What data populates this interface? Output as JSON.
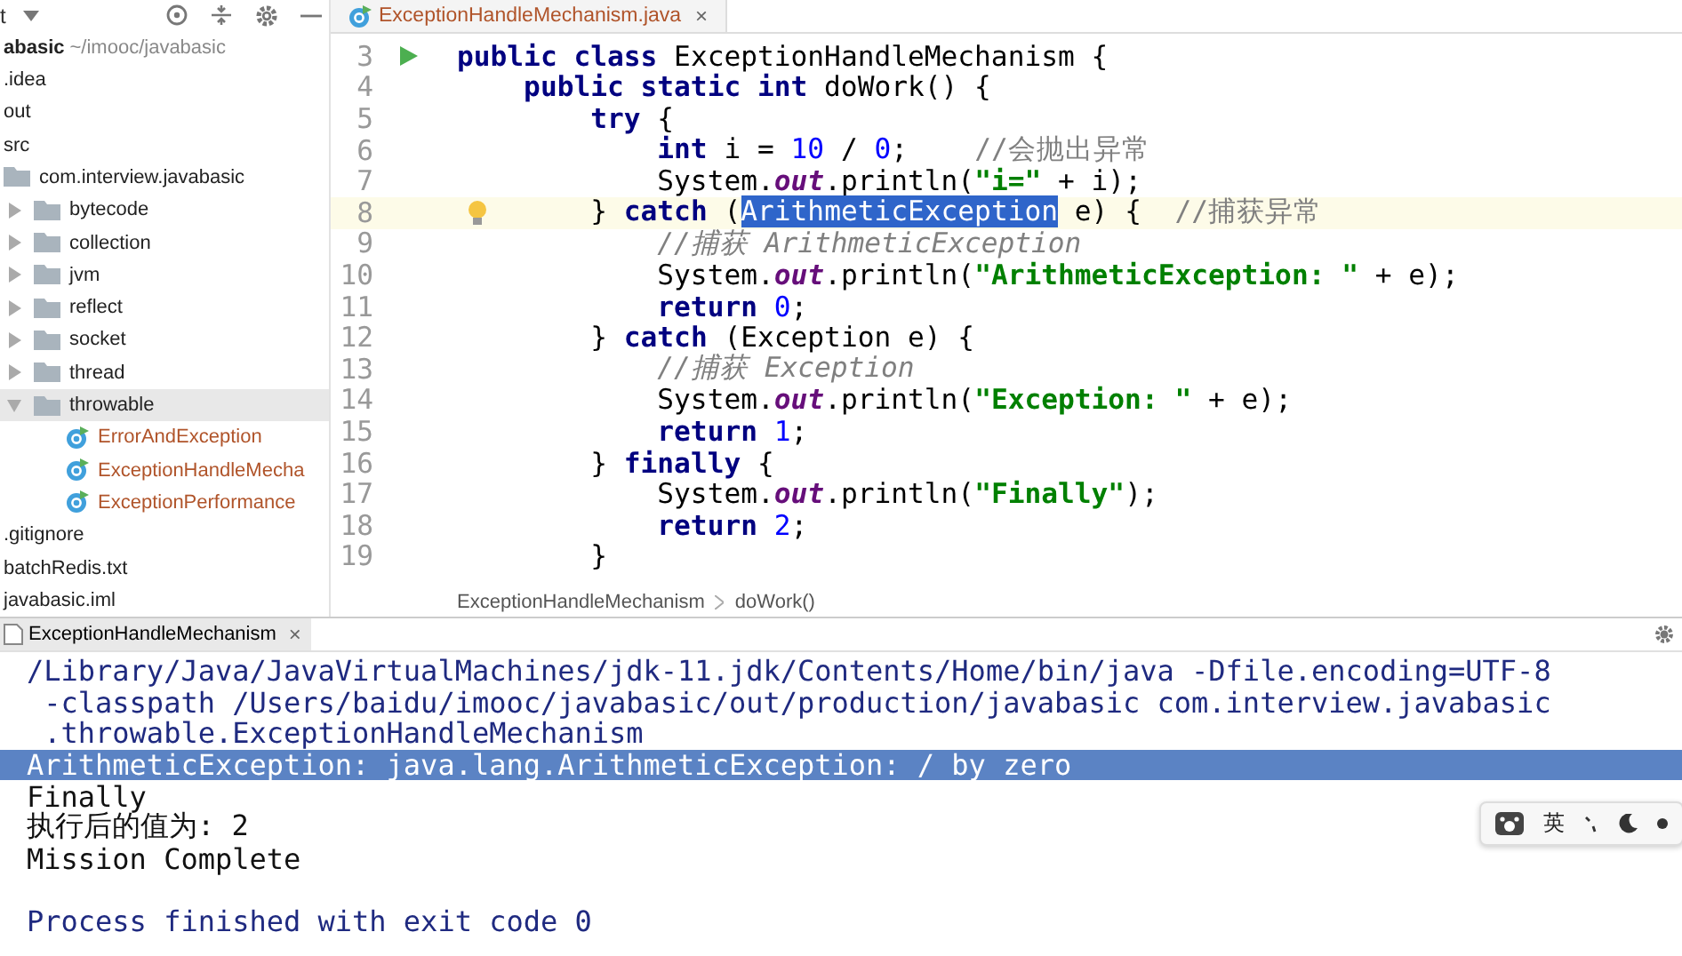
{
  "project_panel": {
    "title": "t",
    "tree": [
      {
        "label": "abasic",
        "path": "~/imooc/javabasic",
        "kind": "root",
        "selected": false,
        "children": [
          {
            "label": ".idea",
            "kind": "plain",
            "selected": false
          },
          {
            "label": "out",
            "kind": "plain",
            "selected": false
          },
          {
            "label": "src",
            "kind": "plain",
            "selected": false,
            "children": [
              {
                "label": "com.interview.javabasic",
                "kind": "package",
                "selected": false,
                "children": [
                  {
                    "label": "bytecode",
                    "kind": "folder",
                    "expanded": false,
                    "selected": false
                  },
                  {
                    "label": "collection",
                    "kind": "folder",
                    "expanded": false,
                    "selected": false
                  },
                  {
                    "label": "jvm",
                    "kind": "folder",
                    "expanded": false,
                    "selected": false
                  },
                  {
                    "label": "reflect",
                    "kind": "folder",
                    "expanded": false,
                    "selected": false
                  },
                  {
                    "label": "socket",
                    "kind": "folder",
                    "expanded": false,
                    "selected": false
                  },
                  {
                    "label": "thread",
                    "kind": "folder",
                    "expanded": false,
                    "selected": false
                  },
                  {
                    "label": "throwable",
                    "kind": "folder",
                    "expanded": true,
                    "selected": true,
                    "children": [
                      {
                        "label": "ErrorAndException",
                        "kind": "class",
                        "selected": false
                      },
                      {
                        "label": "ExceptionHandleMecha",
                        "kind": "class",
                        "selected": false
                      },
                      {
                        "label": "ExceptionPerformance",
                        "kind": "class",
                        "selected": false
                      }
                    ]
                  }
                ]
              }
            ]
          },
          {
            "label": ".gitignore",
            "kind": "plain",
            "selected": false
          },
          {
            "label": "batchRedis.txt",
            "kind": "plain",
            "selected": false
          },
          {
            "label": "javabasic.iml",
            "kind": "plain",
            "selected": false
          }
        ]
      }
    ]
  },
  "editor": {
    "tab": {
      "label": "ExceptionHandleMechanism.java",
      "close": "×"
    },
    "lines": [
      {
        "number": "3",
        "current": false,
        "runnable": true,
        "hint": false,
        "tokens": [
          {
            "kind": "kw",
            "text": "public class"
          },
          {
            "kind": "plain",
            "text": " ExceptionHandleMechanism {"
          }
        ]
      },
      {
        "number": "4",
        "current": false,
        "runnable": false,
        "hint": false,
        "tokens": [
          {
            "kind": "kw",
            "text": "    public static int"
          },
          {
            "kind": "plain",
            "text": " doWork() {"
          }
        ]
      },
      {
        "number": "5",
        "current": false,
        "runnable": false,
        "hint": false,
        "tokens": [
          {
            "kind": "kw",
            "text": "        try"
          },
          {
            "kind": "plain",
            "text": " {"
          }
        ]
      },
      {
        "number": "6",
        "current": false,
        "runnable": false,
        "hint": false,
        "tokens": [
          {
            "kind": "kw",
            "text": "            int"
          },
          {
            "kind": "plain",
            "text": " i = "
          },
          {
            "kind": "num",
            "text": "10"
          },
          {
            "kind": "plain",
            "text": " / "
          },
          {
            "kind": "num",
            "text": "0"
          },
          {
            "kind": "plain",
            "text": ";    "
          },
          {
            "kind": "comment",
            "text": "//会抛出异常"
          }
        ]
      },
      {
        "number": "7",
        "current": false,
        "runnable": false,
        "hint": false,
        "tokens": [
          {
            "kind": "plain",
            "text": "            System."
          },
          {
            "kind": "field",
            "text": "out"
          },
          {
            "kind": "plain",
            "text": ".println("
          },
          {
            "kind": "str",
            "text": "\"i=\""
          },
          {
            "kind": "plain",
            "text": " + i);"
          }
        ]
      },
      {
        "number": "8",
        "current": true,
        "runnable": false,
        "hint": true,
        "tokens": [
          {
            "kind": "plain",
            "text": "        } "
          },
          {
            "kind": "kw",
            "text": "catch"
          },
          {
            "kind": "plain",
            "text": " ("
          },
          {
            "kind": "selection",
            "text": "ArithmeticException"
          },
          {
            "kind": "plain",
            "text": " e) {  "
          },
          {
            "kind": "comment",
            "text": "//捕获异常"
          }
        ]
      },
      {
        "number": "9",
        "current": false,
        "runnable": false,
        "hint": false,
        "tokens": [
          {
            "kind": "doc",
            "text": "            //捕获 ArithmeticException"
          }
        ]
      },
      {
        "number": "10",
        "current": false,
        "runnable": false,
        "hint": false,
        "tokens": [
          {
            "kind": "plain",
            "text": "            System."
          },
          {
            "kind": "field",
            "text": "out"
          },
          {
            "kind": "plain",
            "text": ".println("
          },
          {
            "kind": "str",
            "text": "\"ArithmeticException: \""
          },
          {
            "kind": "plain",
            "text": " + e);"
          }
        ]
      },
      {
        "number": "11",
        "current": false,
        "runnable": false,
        "hint": false,
        "tokens": [
          {
            "kind": "kw",
            "text": "            return"
          },
          {
            "kind": "num",
            "text": " 0"
          },
          {
            "kind": "plain",
            "text": ";"
          }
        ]
      },
      {
        "number": "12",
        "current": false,
        "runnable": false,
        "hint": false,
        "tokens": [
          {
            "kind": "plain",
            "text": "        } "
          },
          {
            "kind": "kw",
            "text": "catch"
          },
          {
            "kind": "plain",
            "text": " (Exception e) {"
          }
        ]
      },
      {
        "number": "13",
        "current": false,
        "runnable": false,
        "hint": false,
        "tokens": [
          {
            "kind": "doc",
            "text": "            //捕获 Exception"
          }
        ]
      },
      {
        "number": "14",
        "current": false,
        "runnable": false,
        "hint": false,
        "tokens": [
          {
            "kind": "plain",
            "text": "            System."
          },
          {
            "kind": "field",
            "text": "out"
          },
          {
            "kind": "plain",
            "text": ".println("
          },
          {
            "kind": "str",
            "text": "\"Exception: \""
          },
          {
            "kind": "plain",
            "text": " + e);"
          }
        ]
      },
      {
        "number": "15",
        "current": false,
        "runnable": false,
        "hint": false,
        "tokens": [
          {
            "kind": "kw",
            "text": "            return"
          },
          {
            "kind": "num",
            "text": " 1"
          },
          {
            "kind": "plain",
            "text": ";"
          }
        ]
      },
      {
        "number": "16",
        "current": false,
        "runnable": false,
        "hint": false,
        "tokens": [
          {
            "kind": "plain",
            "text": "        } "
          },
          {
            "kind": "kw",
            "text": "finally"
          },
          {
            "kind": "plain",
            "text": " {"
          }
        ]
      },
      {
        "number": "17",
        "current": false,
        "runnable": false,
        "hint": false,
        "tokens": [
          {
            "kind": "plain",
            "text": "            System."
          },
          {
            "kind": "field",
            "text": "out"
          },
          {
            "kind": "plain",
            "text": ".println("
          },
          {
            "kind": "str",
            "text": "\"Finally\""
          },
          {
            "kind": "plain",
            "text": ");"
          }
        ]
      },
      {
        "number": "18",
        "current": false,
        "runnable": false,
        "hint": false,
        "tokens": [
          {
            "kind": "kw",
            "text": "            return"
          },
          {
            "kind": "num",
            "text": " 2"
          },
          {
            "kind": "plain",
            "text": ";"
          }
        ]
      },
      {
        "number": "19",
        "current": false,
        "runnable": false,
        "hint": false,
        "tokens": [
          {
            "kind": "plain",
            "text": "        }"
          }
        ]
      }
    ],
    "breadcrumb": [
      "ExceptionHandleMechanism",
      "doWork()"
    ]
  },
  "console": {
    "tab": {
      "label": "ExceptionHandleMechanism",
      "close": "×"
    },
    "lines": [
      {
        "kind": "command",
        "selected": false,
        "text": "/Library/Java/JavaVirtualMachines/jdk-11.jdk/Contents/Home/bin/java -Dfile.encoding=UTF-8"
      },
      {
        "kind": "command",
        "selected": false,
        "text": " -classpath /Users/baidu/imooc/javabasic/out/production/javabasic com.interview.javabasic"
      },
      {
        "kind": "command",
        "selected": false,
        "text": " .throwable.ExceptionHandleMechanism"
      },
      {
        "kind": "output",
        "selected": true,
        "text": "ArithmeticException: java.lang.ArithmeticException: / by zero"
      },
      {
        "kind": "output",
        "selected": false,
        "text": "Finally"
      },
      {
        "kind": "output",
        "selected": false,
        "text": "执行后的值为: 2"
      },
      {
        "kind": "output",
        "selected": false,
        "text": "Mission Complete"
      },
      {
        "kind": "blank",
        "selected": false
      },
      {
        "kind": "command",
        "selected": false,
        "text": "Process finished with exit code 0"
      }
    ]
  },
  "ime_toolbar": {
    "language": "英"
  }
}
